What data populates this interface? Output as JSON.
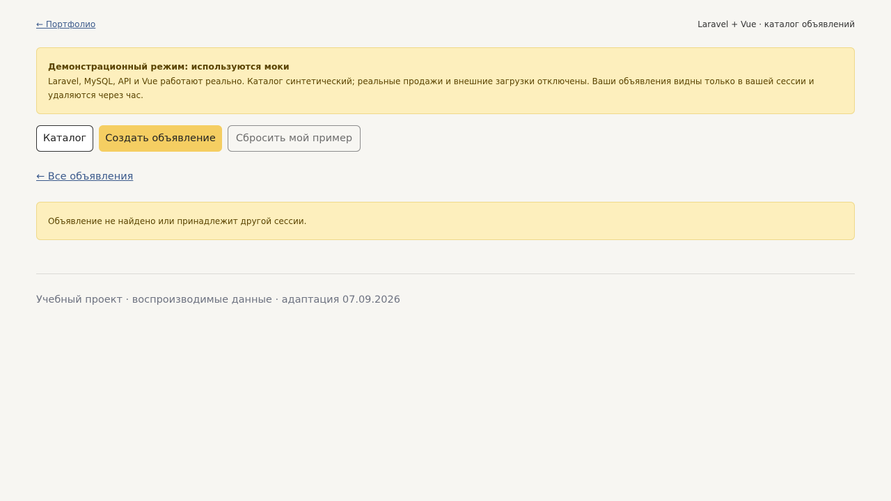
{
  "header": {
    "portfolio_link": "← Портфолио",
    "tagline": "Laravel + Vue · каталог объявлений"
  },
  "demo_banner": {
    "title": "Демонстрационный режим: используются моки",
    "text": "Laravel, MySQL, API и Vue работают реально. Каталог синтетический; реальные продажи и внешние загрузки отключены. Ваши объявления видны только в вашей сессии и удаляются через час."
  },
  "actions": {
    "catalog_label": "Каталог",
    "create_label": "Создать объявление",
    "reset_label": "Сбросить мой пример"
  },
  "back_link": "← Все объявления",
  "notice": "Объявление не найдено или принадлежит другой сессии.",
  "footer": "Учебный проект · воспроизводимые данные · адаптация 07.09.2026",
  "colors": {
    "background": "#f7f6f2",
    "banner_bg": "#fdefbd",
    "banner_border": "#efd98a",
    "accent_button": "#f5ce62",
    "link": "#3b5a8c"
  }
}
